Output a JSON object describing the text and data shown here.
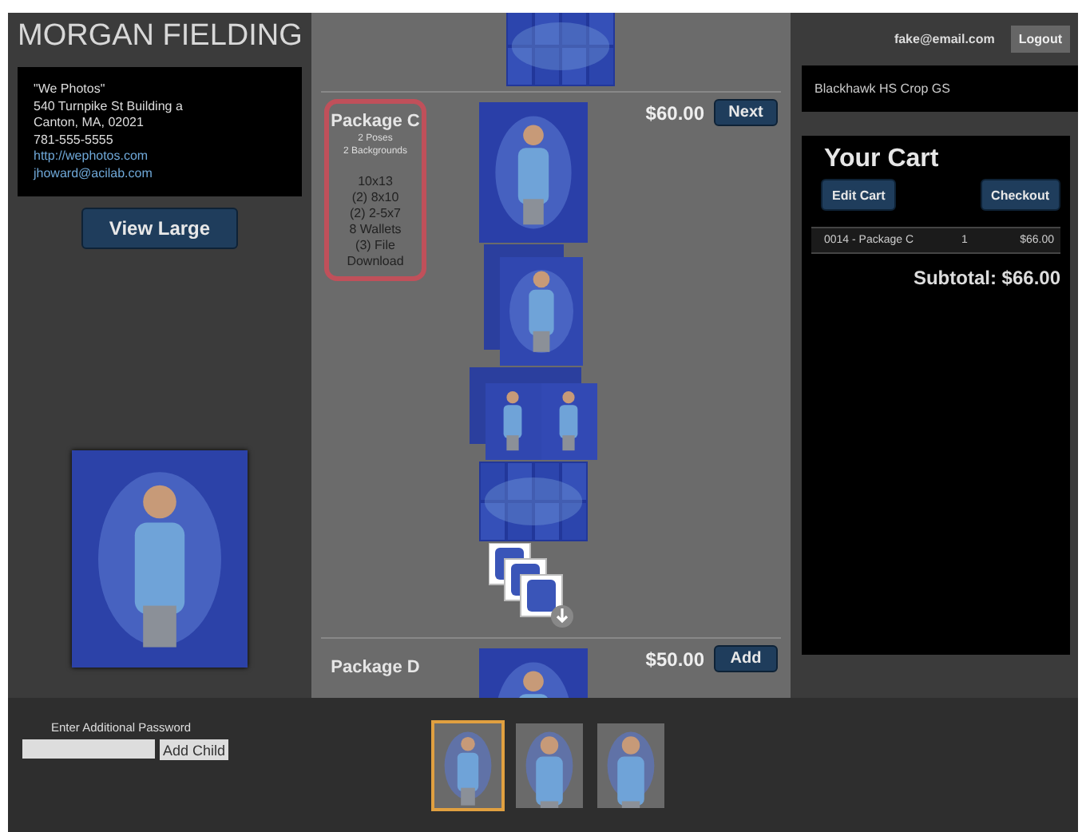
{
  "header": {
    "title": "MORGAN FIELDING"
  },
  "studio": {
    "lines": [
      "\"We Photos\"",
      "540 Turnpike St Building a",
      "Canton, MA, 02021",
      "781-555-5555"
    ],
    "links": [
      "http://wephotos.com",
      "jhoward@acilab.com"
    ]
  },
  "view_large_button": "View Large",
  "packages": [
    {
      "name": "Package C",
      "highlighted": true,
      "subtitle": [
        "2 Poses",
        "2 Backgrounds"
      ],
      "contents": [
        "10x13",
        "(2) 8x10",
        "(2) 2-5x7",
        "8 Wallets",
        "(3) File Download"
      ],
      "price": "$60.00",
      "button": "Next",
      "images": [
        {
          "kind": "single"
        },
        {
          "kind": "double"
        },
        {
          "kind": "pair"
        },
        {
          "kind": "wallets"
        },
        {
          "kind": "download"
        }
      ]
    },
    {
      "name": "Package D",
      "highlighted": false,
      "price": "$50.00",
      "button": "Add",
      "images": [
        {
          "kind": "single"
        }
      ]
    }
  ],
  "account": {
    "email": "fake@email.com",
    "logout": "Logout"
  },
  "gallery": "Blackhawk HS Crop GS",
  "cart": {
    "title": "Your Cart",
    "edit_button": "Edit Cart",
    "checkout_button": "Checkout",
    "items": [
      {
        "item": "0014 - Package C",
        "qty": "1",
        "price": "$66.00"
      }
    ],
    "subtotal": "Subtotal: $66.00"
  },
  "password": {
    "label": "Enter Additional Password",
    "button": "Add Child"
  },
  "thumbnails": [
    {
      "selected": true
    },
    {
      "selected": false
    },
    {
      "selected": false
    }
  ]
}
